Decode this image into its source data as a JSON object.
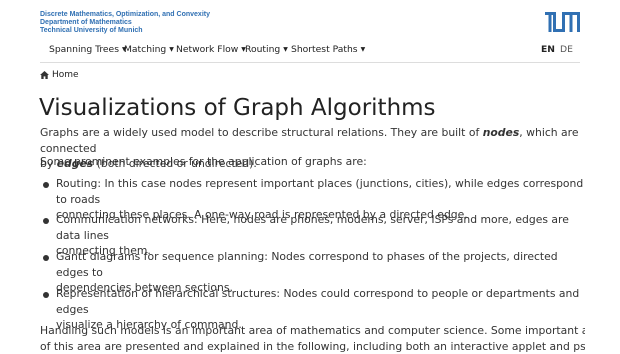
{
  "header": {
    "dept_line1": "Discrete Mathematics, Optimization, and Convexity",
    "dept_line2": "Department of Mathematics",
    "dept_line3": "Technical University of Munich",
    "logo_text": "TUM",
    "logo_color": "#3070b3"
  },
  "nav": {
    "items": [
      {
        "label": "Spanning Trees"
      },
      {
        "label": "Matching"
      },
      {
        "label": "Network Flow"
      },
      {
        "label": "Routing"
      },
      {
        "label": "Shortest Paths"
      }
    ],
    "lang_en": "EN",
    "lang_de": "DE"
  },
  "breadcrumb": {
    "icon": "home-icon",
    "label": "Home"
  },
  "page": {
    "title": "Visualizations of Graph Algorithms",
    "intro_a": "Graphs are a widely used model to describe structural relations. They are built of ",
    "intro_nodes": "nodes",
    "intro_b": ", which are connected",
    "intro_c": "by ",
    "intro_edges": "edges",
    "intro_d": " (both directed or undirected).",
    "examples_intro": "Some prominent examples for the application of graphs are:",
    "bullets": [
      {
        "line1": "Routing: In this case nodes represent important places (junctions, cities), while edges correspond to roads",
        "line2": "connecting these places. A one-way road is represented by a directed edge."
      },
      {
        "line1": "Communication networks: Here, nodes are phones, modems, server, ISPs and more, edges are data lines",
        "line2": "connecting them."
      },
      {
        "line1": "Gantt diagrams for sequence planning: Nodes correspond to phases of the projects, directed edges to",
        "line2": "dependencies between sections."
      },
      {
        "line1": "Representation of hierarchical structures: Nodes could correspond to people or departments and edges",
        "line2": "visualize a hierarchy of command."
      }
    ],
    "outro_line1": "Handling such models is an important area of mathematics and computer science. Some important algorithms",
    "outro_line2": "of this area are presented and explained in the following, including both an interactive applet and pseudocode."
  }
}
